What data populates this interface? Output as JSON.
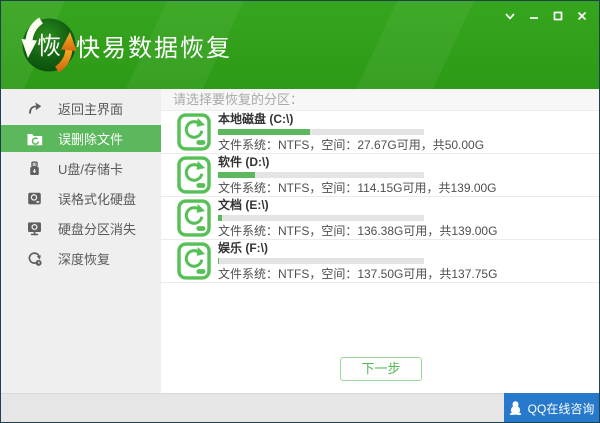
{
  "window": {
    "title": "快易数据恢复",
    "controls": {
      "dropdown": "chevron-down",
      "minimize": "minimize",
      "maximize": "maximize",
      "close": "close"
    }
  },
  "sidebar": {
    "items": [
      {
        "label": "返回主界面",
        "icon": "return-arrow-icon",
        "selected": false
      },
      {
        "label": "误删除文件",
        "icon": "folder-recover-icon",
        "selected": true
      },
      {
        "label": "U盘/存储卡",
        "icon": "usb-drive-icon",
        "selected": false
      },
      {
        "label": "误格式化硬盘",
        "icon": "hard-drive-icon",
        "selected": false
      },
      {
        "label": "硬盘分区消失",
        "icon": "partition-monitor-icon",
        "selected": false
      },
      {
        "label": "深度恢复",
        "icon": "deep-scan-icon",
        "selected": false
      }
    ]
  },
  "main": {
    "prompt": "请选择要恢复的分区：",
    "drives": [
      {
        "name": "本地磁盘 (C:\\)",
        "details": "文件系统：NTFS，空间：27.67G可用，共50.00G",
        "used_percent": 44.7
      },
      {
        "name": "软件 (D:\\)",
        "details": "文件系统：NTFS，空间：114.15G可用，共139.00G",
        "used_percent": 17.9
      },
      {
        "name": "文档 (E:\\)",
        "details": "文件系统：NTFS，空间：136.38G可用，共139.00G",
        "used_percent": 1.9
      },
      {
        "name": "娱乐 (F:\\)",
        "details": "文件系统：NTFS，空间：137.50G可用，共137.75G",
        "used_percent": 0.3
      }
    ],
    "next_button": "下一步"
  },
  "footer": {
    "qq_button": "QQ在线咨询"
  },
  "colors": {
    "header_green": "#2f9e1d",
    "accent_green": "#5cb85c",
    "progress_track": "#e4e4e4",
    "sidebar_bg": "#efefef",
    "qq_blue": "#2779cb",
    "logo_orange": "#f0941d"
  }
}
